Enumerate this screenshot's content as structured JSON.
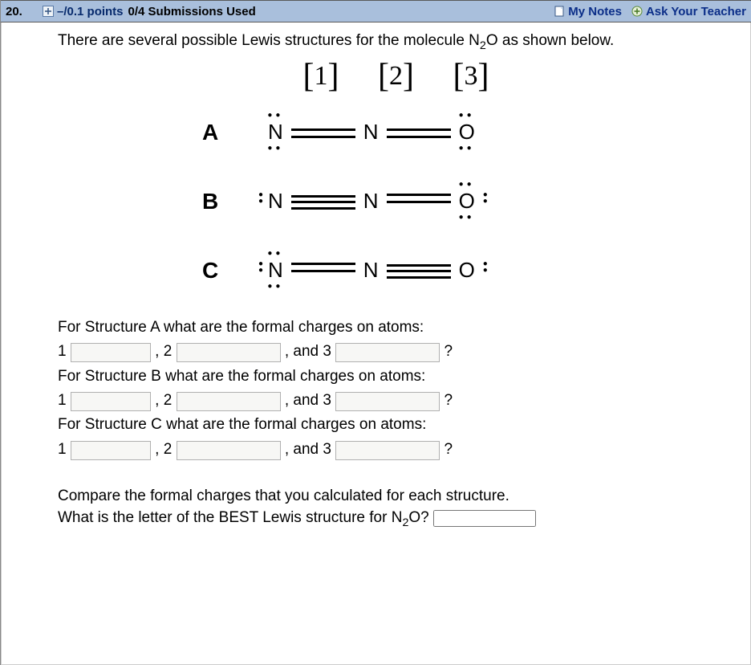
{
  "header": {
    "number": "20.",
    "points": "–/0.1 points",
    "submissions": "0/4 Submissions Used",
    "my_notes": "My Notes",
    "ask": "Ask Your Teacher"
  },
  "intro_prefix": "There are several possible Lewis structures for the molecule N",
  "intro_sub": "2",
  "intro_suffix": "O as shown below.",
  "position_labels": [
    "1",
    "2",
    "3"
  ],
  "structures": [
    {
      "label": "A"
    },
    {
      "label": "B"
    },
    {
      "label": "C"
    }
  ],
  "questions": {
    "promptA": "For Structure A what are the formal charges on atoms:",
    "promptB": "For Structure B what are the formal charges on atoms:",
    "promptC": "For Structure C what are the formal charges on atoms:",
    "seg1": "1",
    "seg2_prefix": ", 2",
    "seg3_prefix": ", and 3",
    "seg_end": "?"
  },
  "compare_line1": "Compare the formal charges that you calculated for each structure.",
  "compare_line2_prefix": "What is the letter of the BEST Lewis structure for N",
  "compare_line2_sub": "2",
  "compare_line2_suffix": "O?"
}
